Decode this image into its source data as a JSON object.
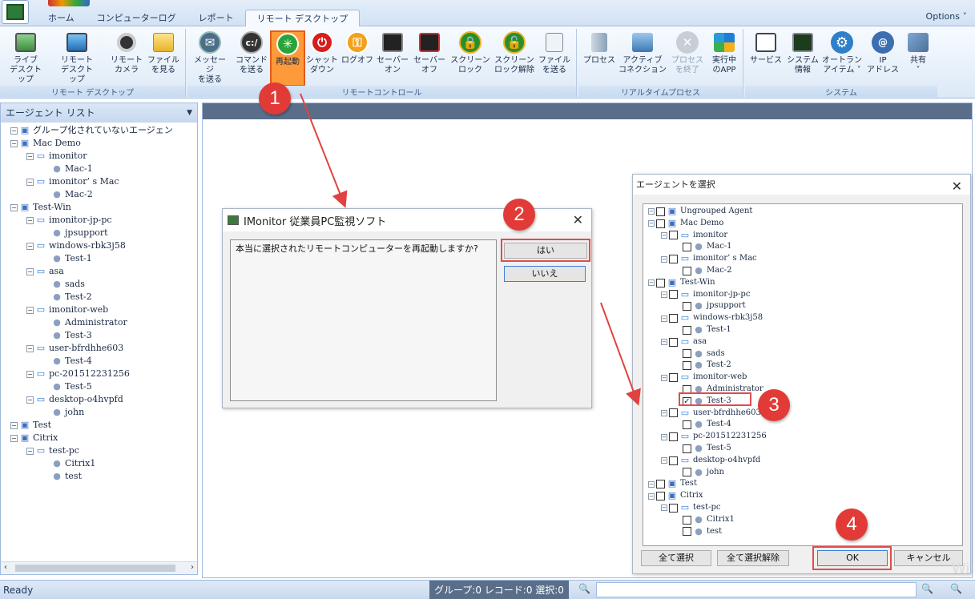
{
  "tabs": [
    "ホーム",
    "コンピューターログ",
    "レポート",
    "リモート デスクトップ"
  ],
  "active_tab": 3,
  "options_label": "Options ˅",
  "ribbon": {
    "groups": [
      {
        "label": "リモート デスクトップ"
      },
      {
        "label": "リモートコントロール"
      },
      {
        "label": "リアルタイムプロセス"
      },
      {
        "label": "システム"
      }
    ],
    "buttons": [
      {
        "label": "ライブ\nデスクトップ",
        "icon": "live-desktop-icon"
      },
      {
        "label": "リモート\nデスクトップ",
        "icon": "remote-desktop-icon"
      },
      {
        "label": "リモート\nカメラ",
        "icon": "camera-icon"
      },
      {
        "label": "ファイル\nを見る",
        "icon": "folder-icon"
      },
      {
        "label": "メッセージ\nを送る",
        "icon": "message-icon"
      },
      {
        "label": "コマンド\nを送る",
        "icon": "command-icon"
      },
      {
        "label": "再起動",
        "icon": "restart-icon"
      },
      {
        "label": "シャット\nダウン",
        "icon": "shutdown-icon"
      },
      {
        "label": "ログオフ",
        "icon": "logoff-icon"
      },
      {
        "label": "セーバー\nオン",
        "icon": "saver-on-icon"
      },
      {
        "label": "セーバー\nオフ",
        "icon": "saver-off-icon"
      },
      {
        "label": "スクリーン\nロック",
        "icon": "lock-icon"
      },
      {
        "label": "スクリーン\nロック解除",
        "icon": "unlock-icon"
      },
      {
        "label": "ファイル\nを送る",
        "icon": "send-file-icon"
      },
      {
        "label": "プロセス",
        "icon": "process-icon"
      },
      {
        "label": "アクティブ\nコネクション",
        "icon": "connection-icon"
      },
      {
        "label": "プロセス\nを終了",
        "icon": "kill-process-icon"
      },
      {
        "label": "実行中\nのAPP",
        "icon": "running-app-icon"
      },
      {
        "label": "サービス",
        "icon": "service-icon"
      },
      {
        "label": "システム\n情報",
        "icon": "system-info-icon"
      },
      {
        "label": "オートラン\nアイテム ˅",
        "icon": "gear-icon"
      },
      {
        "label": "IP\nアドレス",
        "icon": "ip-icon"
      },
      {
        "label": "共有\n˅",
        "icon": "share-icon"
      }
    ]
  },
  "agent_list": {
    "title": "エージェント リスト",
    "nodes": [
      {
        "label": "グループ化されていないエージェン",
        "type": "group"
      },
      {
        "label": "Mac Demo",
        "type": "group"
      },
      {
        "label": "imonitor",
        "type": "pc"
      },
      {
        "label": "Mac-1",
        "type": "user"
      },
      {
        "label": "imonitor’ s Mac",
        "type": "pc"
      },
      {
        "label": "Mac-2",
        "type": "user"
      },
      {
        "label": "Test-Win",
        "type": "group"
      },
      {
        "label": "imonitor-jp-pc",
        "type": "pc"
      },
      {
        "label": "jpsupport",
        "type": "user"
      },
      {
        "label": "windows-rbk3j58",
        "type": "pc"
      },
      {
        "label": "Test-1",
        "type": "user"
      },
      {
        "label": "asa",
        "type": "pc"
      },
      {
        "label": "sads",
        "type": "user"
      },
      {
        "label": "Test-2",
        "type": "user"
      },
      {
        "label": "imonitor-web",
        "type": "pc"
      },
      {
        "label": "Administrator",
        "type": "user"
      },
      {
        "label": "Test-3",
        "type": "user"
      },
      {
        "label": "user-bfrdhhe603",
        "type": "pc"
      },
      {
        "label": "Test-4",
        "type": "user"
      },
      {
        "label": "pc-201512231256",
        "type": "pc"
      },
      {
        "label": "Test-5",
        "type": "user"
      },
      {
        "label": "desktop-o4hvpfd",
        "type": "pc"
      },
      {
        "label": "john",
        "type": "user"
      },
      {
        "label": "Test",
        "type": "group"
      },
      {
        "label": "Citrix",
        "type": "group"
      },
      {
        "label": "test-pc",
        "type": "pc"
      },
      {
        "label": "Citrix1",
        "type": "user"
      },
      {
        "label": "test",
        "type": "user"
      }
    ]
  },
  "confirm_dialog": {
    "title": "IMonitor 従業員PC監視ソフト",
    "message": "本当に選択されたリモートコンピューターを再起動しますか?",
    "yes": "はい",
    "no": "いいえ"
  },
  "select_dialog": {
    "title": "エージェントを選択",
    "nodes": [
      {
        "label": "Ungrouped Agent",
        "checked": false
      },
      {
        "label": "Mac Demo",
        "checked": false
      },
      {
        "label": "imonitor",
        "checked": false
      },
      {
        "label": "Mac-1",
        "checked": false
      },
      {
        "label": "imonitor’ s Mac",
        "checked": false
      },
      {
        "label": "Mac-2",
        "checked": false
      },
      {
        "label": "Test-Win",
        "checked": false
      },
      {
        "label": "imonitor-jp-pc",
        "checked": false
      },
      {
        "label": "jpsupport",
        "checked": false
      },
      {
        "label": "windows-rbk3j58",
        "checked": false
      },
      {
        "label": "Test-1",
        "checked": false
      },
      {
        "label": "asa",
        "checked": false
      },
      {
        "label": "sads",
        "checked": false
      },
      {
        "label": "Test-2",
        "checked": false
      },
      {
        "label": "imonitor-web",
        "checked": false
      },
      {
        "label": "Administrator",
        "checked": false
      },
      {
        "label": "Test-3",
        "checked": true
      },
      {
        "label": "user-bfrdhhe603",
        "checked": false
      },
      {
        "label": "Test-4",
        "checked": false
      },
      {
        "label": "pc-201512231256",
        "checked": false
      },
      {
        "label": "Test-5",
        "checked": false
      },
      {
        "label": "desktop-o4hvpfd",
        "checked": false
      },
      {
        "label": "john",
        "checked": false
      },
      {
        "label": "Test",
        "checked": false
      },
      {
        "label": "Citrix",
        "checked": false
      },
      {
        "label": "test-pc",
        "checked": false
      },
      {
        "label": "Citrix1",
        "checked": false
      },
      {
        "label": "test",
        "checked": false
      }
    ],
    "select_all": "全て選択",
    "deselect_all": "全て選択解除",
    "ok": "OK",
    "cancel": "キャンセル"
  },
  "annotations": [
    "1",
    "2",
    "3",
    "4"
  ],
  "status": {
    "ready": "Ready",
    "counts": "グループ:0 レコード:0 選択:0"
  },
  "colors": {
    "highlight": "#ff9a3a",
    "annotation": "#e23b37",
    "accent": "#3c7fd6"
  }
}
